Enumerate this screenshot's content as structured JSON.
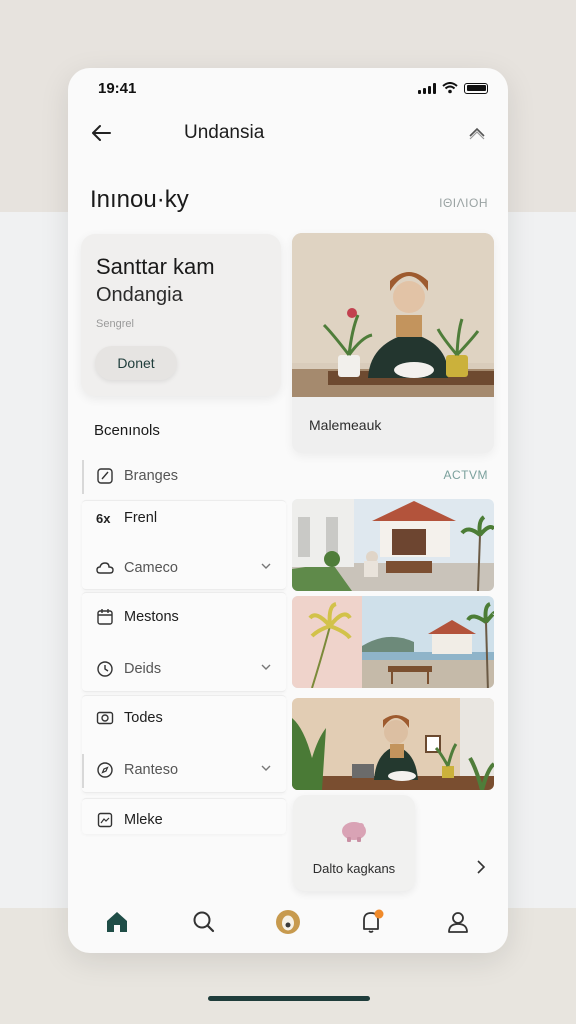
{
  "status": {
    "time": "19:41"
  },
  "header": {
    "title": "Undansia"
  },
  "section": {
    "title": "Inınou·ky",
    "right_label": "IΘΙΛΙΟΗ"
  },
  "hero": {
    "line1": "Santtar kam",
    "line2": "Ondangia",
    "sub": "Sengrel",
    "button": "Donet"
  },
  "feature_photo": {
    "label": "Malemeauk"
  },
  "list": {
    "heading": "Bcenınols",
    "right_label": "ACTVM",
    "items": [
      {
        "label": "Branges",
        "icon": "brush-icon"
      },
      {
        "label": "Frenl",
        "icon": "text-format-icon"
      },
      {
        "label": "Cameco",
        "icon": "cloud-icon"
      },
      {
        "label": "Mestons",
        "icon": "calendar-icon"
      },
      {
        "label": "Deids",
        "icon": "clock-icon"
      },
      {
        "label": "Todes",
        "icon": "camera-icon"
      },
      {
        "label": "Ranteso",
        "icon": "compass-icon"
      },
      {
        "label": "Mleke",
        "icon": "image-icon"
      }
    ]
  },
  "mini_card": {
    "label": "Dalto kagkans",
    "icon": "piggy-bank-icon"
  },
  "tabbar": {
    "tabs": [
      "home-icon",
      "search-icon",
      "egg-icon",
      "notification-icon",
      "profile-icon"
    ]
  },
  "colors": {
    "accent": "#1f4d47",
    "badge": "#f08a2a",
    "gold": "#c79a4e"
  }
}
